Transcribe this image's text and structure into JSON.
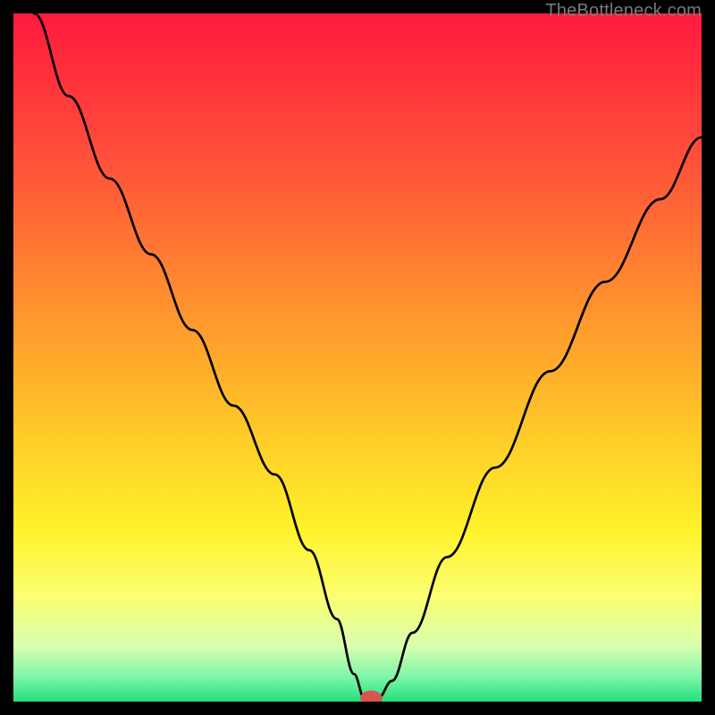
{
  "watermark": "TheBottleneck.com",
  "chart_data": {
    "type": "line",
    "title": "",
    "xlabel": "",
    "ylabel": "",
    "xlim": [
      0,
      100
    ],
    "ylim": [
      0,
      100
    ],
    "grid": false,
    "legend": false,
    "background_gradient_stops": [
      {
        "offset": 0.0,
        "color": "#ff1a3e"
      },
      {
        "offset": 0.2,
        "color": "#ff4d3a"
      },
      {
        "offset": 0.4,
        "color": "#ff8a2f"
      },
      {
        "offset": 0.6,
        "color": "#ffc728"
      },
      {
        "offset": 0.75,
        "color": "#fff22a"
      },
      {
        "offset": 0.85,
        "color": "#fbff73"
      },
      {
        "offset": 0.92,
        "color": "#d7ffb0"
      },
      {
        "offset": 0.965,
        "color": "#7cf5a9"
      },
      {
        "offset": 1.0,
        "color": "#22e07a"
      }
    ],
    "series": [
      {
        "name": "bottleneck-curve",
        "x": [
          3,
          8,
          14,
          20,
          26,
          32,
          38,
          43,
          47,
          49.5,
          51,
          53,
          55,
          58,
          63,
          70,
          78,
          86,
          94,
          100
        ],
        "y": [
          100,
          88,
          76,
          65,
          54,
          43,
          33,
          22,
          12,
          4,
          0.5,
          0.5,
          3,
          10,
          21,
          34,
          48,
          61,
          73,
          82
        ]
      }
    ],
    "marker": {
      "x": 52,
      "y": 0.5,
      "color": "#d9534f",
      "rx": 1.6,
      "ry": 1.1
    },
    "annotations": []
  }
}
